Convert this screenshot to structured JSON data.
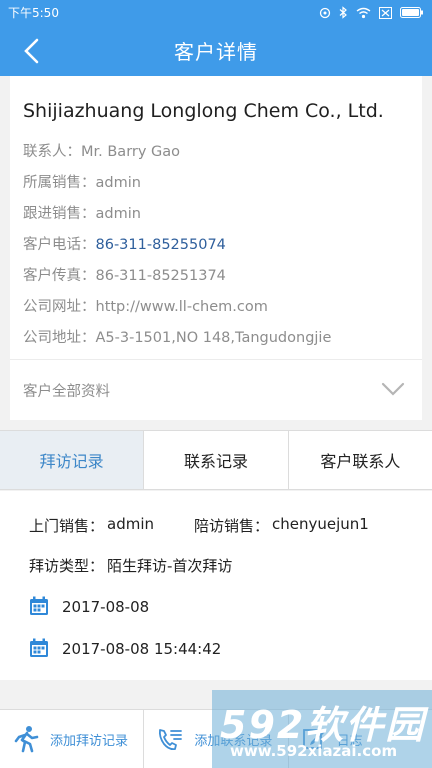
{
  "status_bar": {
    "time": "下午5:50"
  },
  "header": {
    "title": "客户详情"
  },
  "customer": {
    "company": "Shijiazhuang Longlong Chem Co., Ltd.",
    "rows": [
      {
        "label": "联系人：",
        "value": "Mr. Barry Gao"
      },
      {
        "label": "所属销售：",
        "value": "admin"
      },
      {
        "label": "跟进销售：",
        "value": "admin"
      },
      {
        "label": "客户电话：",
        "value": "86-311-85255074"
      },
      {
        "label": "客户传真：",
        "value": "86-311-85251374"
      },
      {
        "label": "公司网址：",
        "value": "http://www.ll-chem.com"
      },
      {
        "label": "公司地址：",
        "value": "A5-3-1501,NO 148,Tangudongjie"
      }
    ],
    "more_label": "客户全部资料"
  },
  "tabs": [
    {
      "label": "拜访记录",
      "active": true
    },
    {
      "label": "联系记录",
      "active": false
    },
    {
      "label": "客户联系人",
      "active": false
    }
  ],
  "visit": {
    "door_sales_label": "上门销售：",
    "door_sales_value": "admin",
    "accompany_label": "陪访销售：",
    "accompany_value": "chenyuejun1",
    "type_label": "拜访类型：",
    "type_value": "陌生拜访-首次拜访",
    "date": "2017-08-08",
    "datetime": "2017-08-08 15:44:42"
  },
  "bottom_bar": {
    "add_visit": "添加拜访记录",
    "add_contact": "添加联系记录",
    "third": "日志"
  },
  "watermark": {
    "brand": "592软件园",
    "url": "www.592xiazai.com"
  },
  "colors": {
    "primary": "#3f9be9",
    "link": "#2f5f9c",
    "tab_active": "#3d87c8"
  }
}
